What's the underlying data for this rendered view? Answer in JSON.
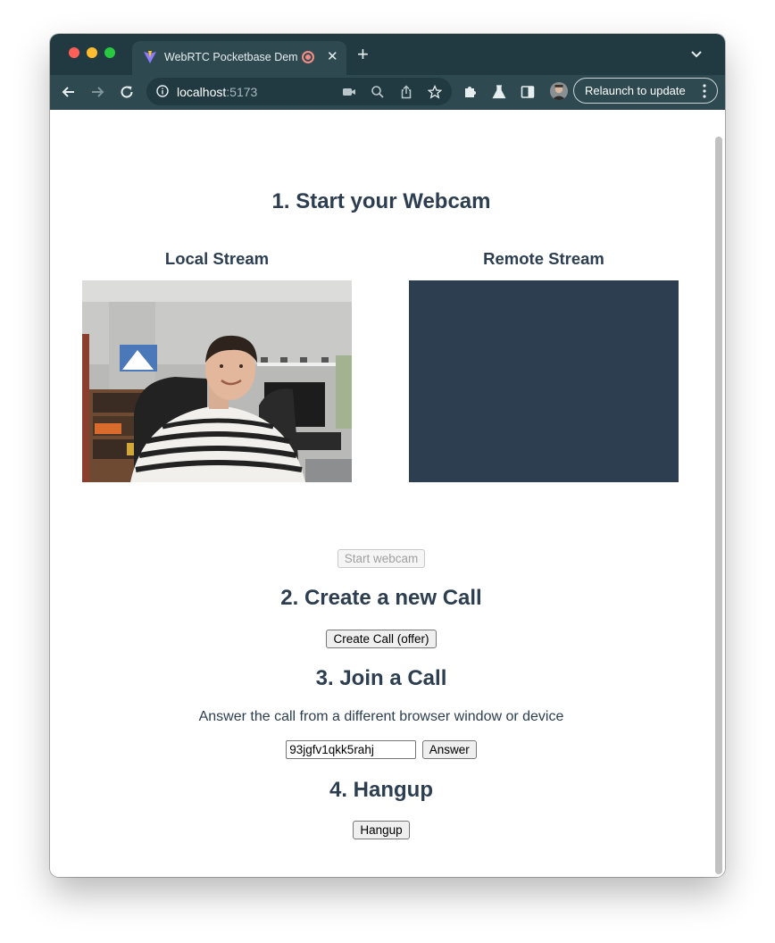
{
  "browser": {
    "tab_title": "WebRTC Pocketbase Demo",
    "new_tab_label": "+",
    "url_host": "localhost",
    "url_port": ":5173",
    "relaunch_label": "Relaunch to update"
  },
  "page": {
    "step1_heading": "1. Start your Webcam",
    "local_stream_label": "Local Stream",
    "remote_stream_label": "Remote Stream",
    "start_webcam_label": "Start webcam",
    "step2_heading": "2. Create a new Call",
    "create_call_label": "Create Call (offer)",
    "step3_heading": "3. Join a Call",
    "join_description": "Answer the call from a different browser window or device",
    "call_id_value": "93jgfv1qkk5rahj",
    "answer_label": "Answer",
    "step4_heading": "4. Hangup",
    "hangup_label": "Hangup"
  },
  "colors": {
    "heading_text": "#2c3e50",
    "remote_video_bg": "#2c3e50",
    "titlebar_bg": "#213a42",
    "toolbar_bg": "#2e4950"
  }
}
